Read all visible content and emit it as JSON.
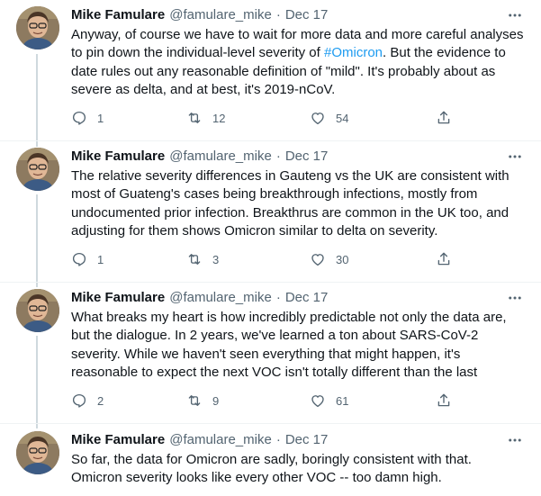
{
  "tweets": [
    {
      "name": "Mike Famulare",
      "handle": "@famulare_mike",
      "separator": "·",
      "date": "Dec 17",
      "lines": [
        "Anyway, of course we have to wait for more data and more careful analyses",
        "to pin down the individual-level severity of ",
        "date rules out any reasonable definition of \"mild\". It's probably about as",
        "severe as delta, and at best, it's 2019-nCoV."
      ],
      "hashtag": "#Omicron",
      "line2_tail": ". But the evidence to",
      "replies": "1",
      "retweets": "12",
      "likes": "54"
    },
    {
      "name": "Mike Famulare",
      "handle": "@famulare_mike",
      "separator": "·",
      "date": "Dec 17",
      "lines": [
        "The relative severity differences in Gauteng vs the UK are consistent with",
        "most of Guateng's cases being breakthrough infections, mostly from",
        "undocumented prior infection. Breakthrus are common in the UK too, and",
        "adjusting for them shows Omicron similar to delta on severity."
      ],
      "replies": "1",
      "retweets": "3",
      "likes": "30"
    },
    {
      "name": "Mike Famulare",
      "handle": "@famulare_mike",
      "separator": "·",
      "date": "Dec 17",
      "lines": [
        "What breaks my heart is how incredibly predictable not only the data are,",
        "but the dialogue.  In 2 years, we've learned a ton about SARS-CoV-2",
        "severity. While we haven't seen everything that might happen, it's",
        "reasonable to expect the next VOC isn't totally different than the last"
      ],
      "replies": "2",
      "retweets": "9",
      "likes": "61"
    },
    {
      "name": "Mike Famulare",
      "handle": "@famulare_mike",
      "separator": "·",
      "date": "Dec 17",
      "lines": [
        "So far, the data for Omicron are sadly, boringly consistent with that.",
        "Omicron severity looks like every other VOC -- too damn high."
      ]
    }
  ],
  "icons": {
    "more": "more-horizontal-icon",
    "reply": "reply-icon",
    "retweet": "retweet-icon",
    "like": "heart-icon",
    "share": "share-icon"
  },
  "colors": {
    "text": "#0f1419",
    "secondary": "#536471",
    "link": "#1d9bf0",
    "thread_line": "#cfd9de"
  }
}
